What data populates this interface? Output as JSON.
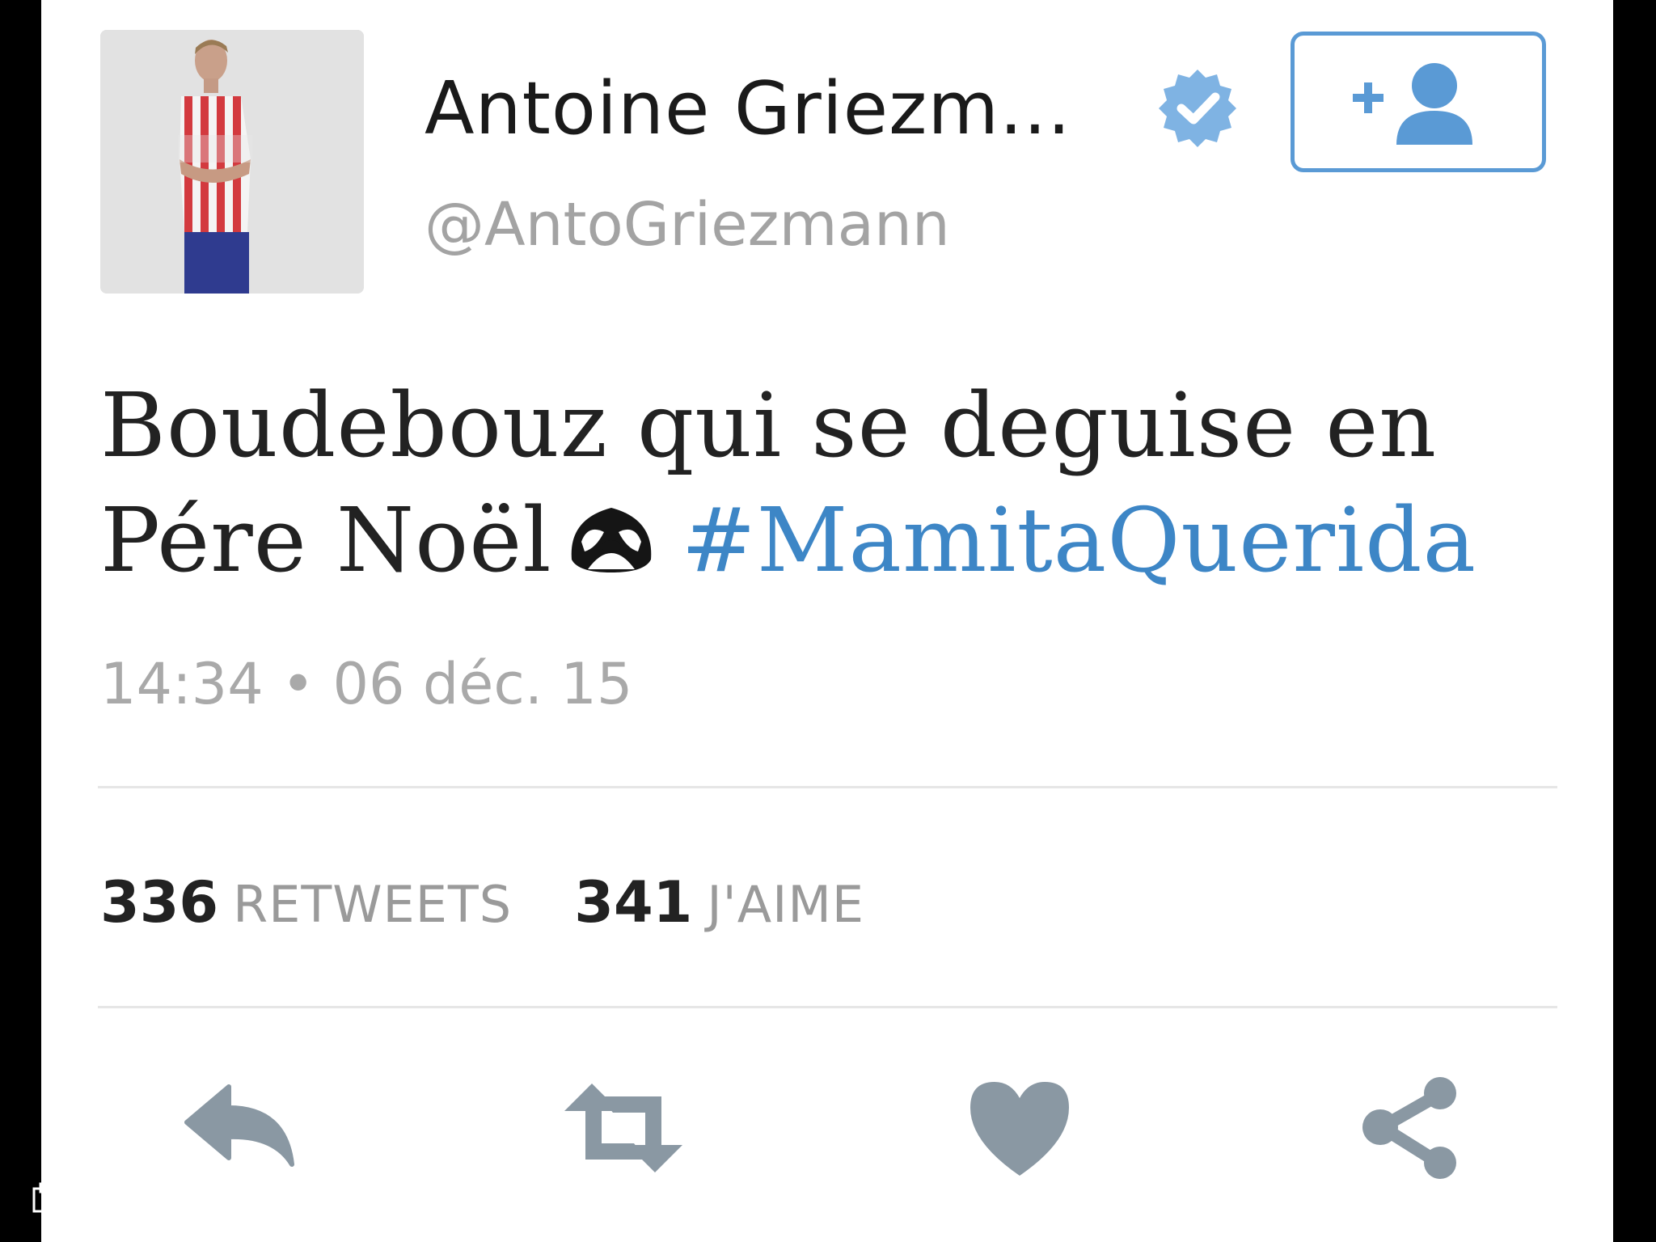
{
  "author": {
    "display_name": "Antoine Griezm...",
    "handle": "@AntoGriezmann",
    "verified_icon": "verified-badge-icon",
    "avatar_icon": "avatar-photo"
  },
  "follow_button": {
    "icon": "follow-user-plus-icon"
  },
  "tweet": {
    "text_line1": "Boudebouz qui se deguise en",
    "text_line2": "Pére Noël",
    "emoji": "sloth-emoji-icon",
    "hashtag": "#MamitaQuerida",
    "timestamp": "14:34 • 06 déc. 15"
  },
  "stats": {
    "retweets_count": "336",
    "retweets_label": "RETWEETS",
    "likes_count": "341",
    "likes_label": "J'AIME"
  },
  "actions": [
    {
      "icon": "reply-icon"
    },
    {
      "icon": "retweet-icon"
    },
    {
      "icon": "heart-icon"
    },
    {
      "icon": "share-icon"
    }
  ],
  "colors": {
    "accent": "#3d86c6",
    "follow_border": "#5a9ad5",
    "icon_gray": "#8a98a3",
    "muted_text": "#a3a3a3"
  }
}
